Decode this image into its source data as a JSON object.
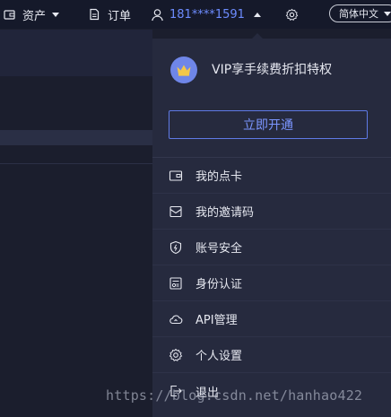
{
  "topbar": {
    "assets_label": "资产",
    "orders_label": "订单",
    "user_phone": "181****1591",
    "language": "简体中文"
  },
  "dropdown": {
    "vip_text": "VIP享手续费折扣特权",
    "open_button": "立即开通",
    "items": [
      {
        "label": "我的点卡",
        "icon": "card-icon"
      },
      {
        "label": "我的邀请码",
        "icon": "invite-icon"
      },
      {
        "label": "账号安全",
        "icon": "shield-icon"
      },
      {
        "label": "身份认证",
        "icon": "id-card-icon"
      },
      {
        "label": "API管理",
        "icon": "api-cloud-icon"
      },
      {
        "label": "个人设置",
        "icon": "gear-icon"
      },
      {
        "label": "退出",
        "icon": "logout-icon"
      }
    ]
  },
  "watermark": "https://blog.csdn.net/hanhao422",
  "colors": {
    "accent": "#6d8cff",
    "background": "#1b1e2d",
    "dropdown": "#262a3e"
  }
}
